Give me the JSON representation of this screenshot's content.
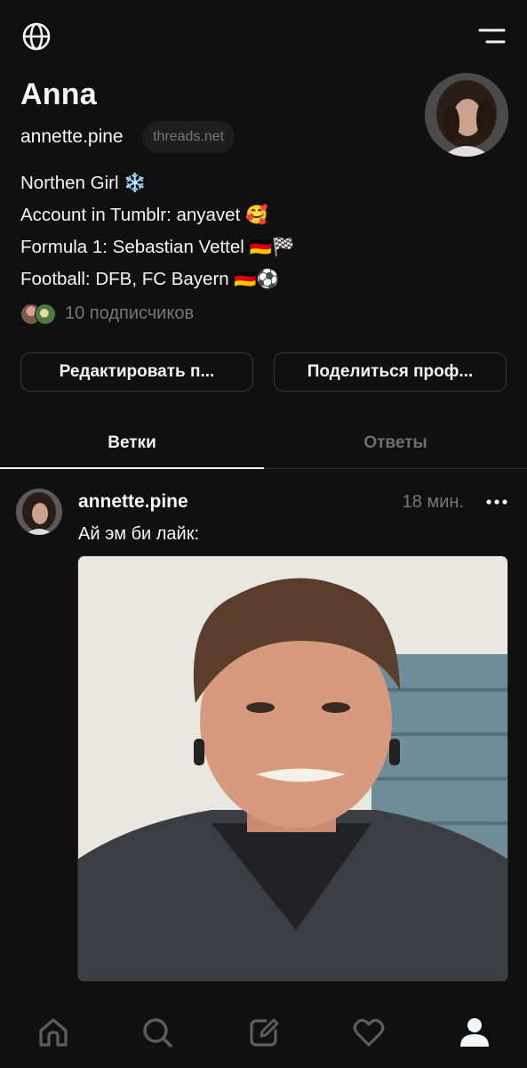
{
  "top_bar": {
    "left_icon": "globe-icon",
    "right_icon": "menu-icon"
  },
  "profile": {
    "display_name": "Anna",
    "username": "annette.pine",
    "domain_badge": "threads.net",
    "bio_lines": [
      "Northen Girl ❄️",
      "Account in Tumblr: anyavet 🥰",
      "Formula 1: Sebastian Vettel 🇩🇪🏁",
      "Football: DFB, FC Bayern 🇩🇪⚽"
    ],
    "followers_text": "10 подписчиков"
  },
  "buttons": {
    "edit_label": "Редактировать п...",
    "share_label": "Поделиться проф..."
  },
  "tabs": [
    {
      "label": "Ветки",
      "active": true
    },
    {
      "label": "Ответы",
      "active": false
    }
  ],
  "post": {
    "username": "annette.pine",
    "time": "18 мин.",
    "text": "Ай эм би лайк:",
    "media": "photo-of-man-grimacing"
  },
  "bottom_nav": [
    "home-icon",
    "search-icon",
    "compose-icon",
    "heart-icon",
    "profile-icon"
  ],
  "colors": {
    "background": "#101010",
    "text_primary": "#f3f5f7",
    "text_secondary": "#777777",
    "border": "#3b3b3b"
  }
}
